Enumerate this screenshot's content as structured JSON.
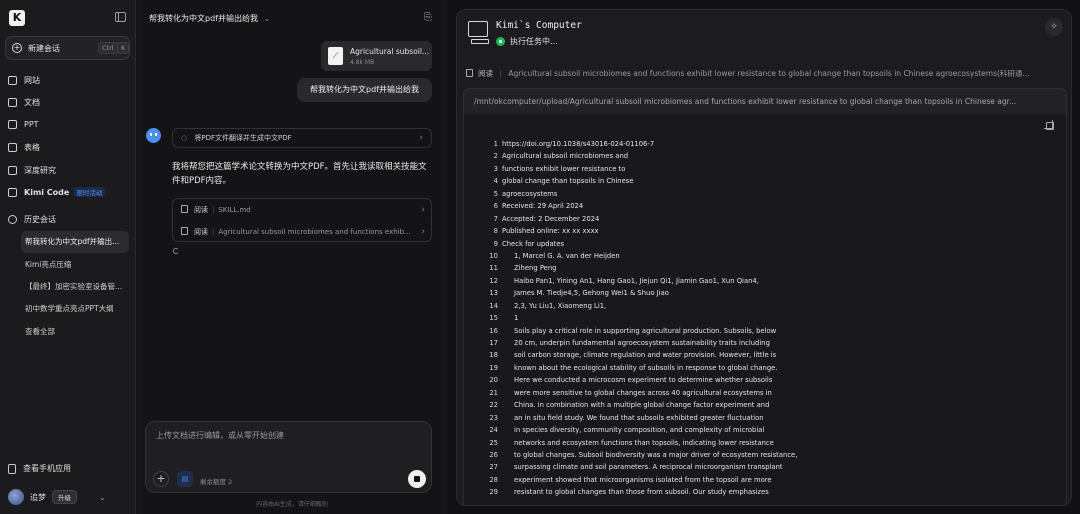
{
  "sidebar": {
    "logo": "K",
    "new_chat": {
      "label": "新建会话",
      "kbd1": "Ctrl",
      "kbd2": "K"
    },
    "nav": [
      {
        "label": "网站",
        "icon": "website-icon"
      },
      {
        "label": "文档",
        "icon": "document-icon"
      },
      {
        "label": "PPT",
        "icon": "ppt-icon"
      },
      {
        "label": "表格",
        "icon": "sheet-icon"
      },
      {
        "label": "深度研究",
        "icon": "research-icon"
      },
      {
        "label": "Kimi Code",
        "icon": "code-icon",
        "badge": "限时活动"
      }
    ],
    "history_label": "历史会话",
    "history": [
      "帮我转化为中文pdf并输出...",
      "Kimi亮点压缩",
      "【最终】加密实验室设备管...",
      "初中数学重点亮点PPT大纲",
      "查看全部"
    ],
    "mobile_app": "查看手机应用",
    "user": {
      "name": "追梦",
      "upgrade": "升级"
    }
  },
  "chat": {
    "title": "帮我转化为中文pdf并输出给我",
    "file": {
      "name": "Agricultural subsoil...",
      "size": "4.8k MB"
    },
    "user_message": "帮我转化为中文pdf并输出给我",
    "step": "将PDF文件翻译并生成中文PDF",
    "reply": "我将帮您把这篇学术论文转换为中文PDF。首先让我读取相关技能文件和PDF内容。",
    "reads": [
      {
        "action": "阅读",
        "arg": "SKILL.md"
      },
      {
        "action": "阅读",
        "arg": "Agricultural subsoil microbiomes and functions exhib..."
      }
    ],
    "input_placeholder": "上传文档进行编辑，或从零开始创建",
    "quota": "剩余额度 2",
    "disclaimer": "内容由AI生成，请仔细甄别"
  },
  "computer": {
    "title": "Kimi`s Computer",
    "status": "执行任务中...",
    "read_label": "阅读",
    "read_target": "Agricultural subsoil microbiomes and functions exhibit lower resistance to global change than topsoils in Chinese agroecosystems(科研通...",
    "path": "/mnt/okcomputer/upload/Agricultural subsoil microbiomes and functions exhibit lower resistance to global change than topsoils in Chinese agr...",
    "lines": [
      {
        "n": "1",
        "t": "https://doi.org/10.1038/s43016-024-01106-7"
      },
      {
        "n": "2",
        "t": "Agricultural subsoil microbiomes and"
      },
      {
        "n": "3",
        "t": "functions exhibit lower resistance to"
      },
      {
        "n": "4",
        "t": "global change than topsoils in Chinese"
      },
      {
        "n": "5",
        "t": "agroecosystems"
      },
      {
        "n": "6",
        "t": "Received: 29 April 2024"
      },
      {
        "n": "7",
        "t": "Accepted: 2 December 2024"
      },
      {
        "n": "8",
        "t": "Published online: xx xx xxxx"
      },
      {
        "n": "9",
        "t": "Check for updates"
      },
      {
        "n": "10",
        "t": "1, Marcel G. A. van der Heijden"
      },
      {
        "n": "11",
        "t": "Ziheng Peng"
      },
      {
        "n": "12",
        "t": "Haibo Pan1, Yining An1, Hang Gao1, Jiejun Qi1, Jiamin Gao1, Xun Qian4,"
      },
      {
        "n": "13",
        "t": "James M. Tiedje4,5, Gehong Wei1 & Shuo Jiao"
      },
      {
        "n": "14",
        "t": "2,3, Yu Liu1, Xiaomeng Li1,"
      },
      {
        "n": "15",
        "t": "1"
      },
      {
        "n": "16",
        "t": "Soils play a critical role in supporting agricultural production. Subsoils, below"
      },
      {
        "n": "17",
        "t": "20 cm, underpin fundamental agroecosystem sustainability traits including"
      },
      {
        "n": "18",
        "t": "soil carbon storage, climate regulation and water provision. However, little is"
      },
      {
        "n": "19",
        "t": "known about the ecological stability of subsoils in response to global change."
      },
      {
        "n": "20",
        "t": "Here we conducted a microcosm experiment to determine whether subsoils"
      },
      {
        "n": "21",
        "t": "were more sensitive to global changes across 40 agricultural ecosystems in"
      },
      {
        "n": "22",
        "t": "China. in combination with a multiple global change factor experiment and"
      },
      {
        "n": "23",
        "t": "an in situ field study. We found that subsoils exhibited greater fluctuation"
      },
      {
        "n": "24",
        "t": "in species diversity, community composition, and complexity of microbial"
      },
      {
        "n": "25",
        "t": "networks and ecosystem functions than topsoils, indicating lower resistance"
      },
      {
        "n": "26",
        "t": "to global changes. Subsoil biodiversity was a major driver of ecosystem resistance,"
      },
      {
        "n": "27",
        "t": "surpassing climate and soil parameters. A reciprocal microorganism transplant"
      },
      {
        "n": "28",
        "t": "experiment showed that microorganisms isolated from the topsoil are more"
      },
      {
        "n": "29",
        "t": "resistant to global changes than those from subsoil. Our study emphasizes"
      }
    ]
  }
}
